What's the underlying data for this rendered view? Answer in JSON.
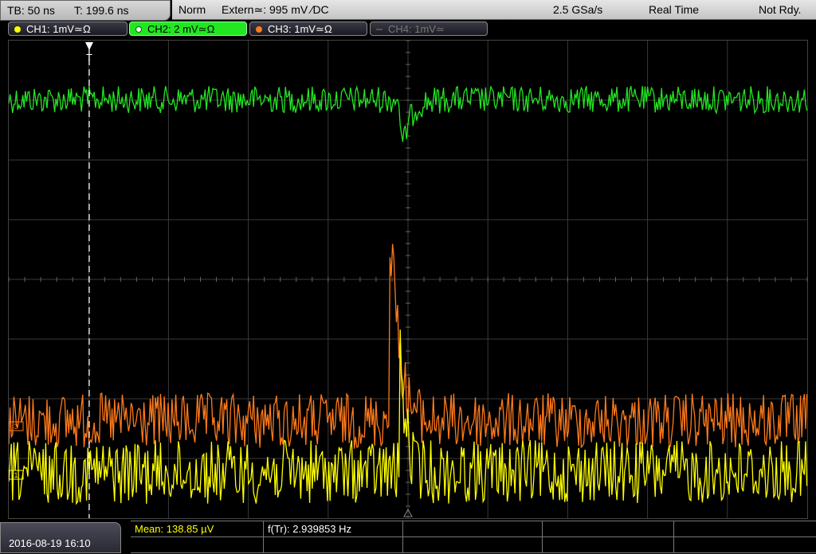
{
  "timebase": {
    "tb": "TB: 50 ns",
    "t": "T: 199.6 ns"
  },
  "status": {
    "mode": "Norm",
    "trigger": "Extern≃: 995 mV ∕DC",
    "sample_rate": "2.5 GSa/s",
    "acq": "Real Time",
    "ready": "Not Rdy."
  },
  "channels": [
    {
      "label": "CH1: 1mV≃Ω",
      "color": "#ffff00",
      "state": "on"
    },
    {
      "label": "CH2: 2 mV≃Ω",
      "color": "#22e622",
      "state": "active"
    },
    {
      "label": "CH3: 1mV≃Ω",
      "color": "#ff7a1a",
      "state": "on"
    },
    {
      "label": "CH4: 1mV≃",
      "color": "#777777",
      "state": "off"
    }
  ],
  "plot": {
    "trigger_marker": "T",
    "ch1_marker": "1",
    "ch3_marker": "3"
  },
  "bottom": {
    "datetime": "2016-08-19 16:10",
    "mean": "Mean: 138.85 µV",
    "freq": "f(Tr): 2.939853 Hz"
  },
  "colors": {
    "ch1": "#ffff00",
    "ch2": "#22e622",
    "ch3": "#ff7a1a",
    "grid": "#3a3a3a"
  }
}
